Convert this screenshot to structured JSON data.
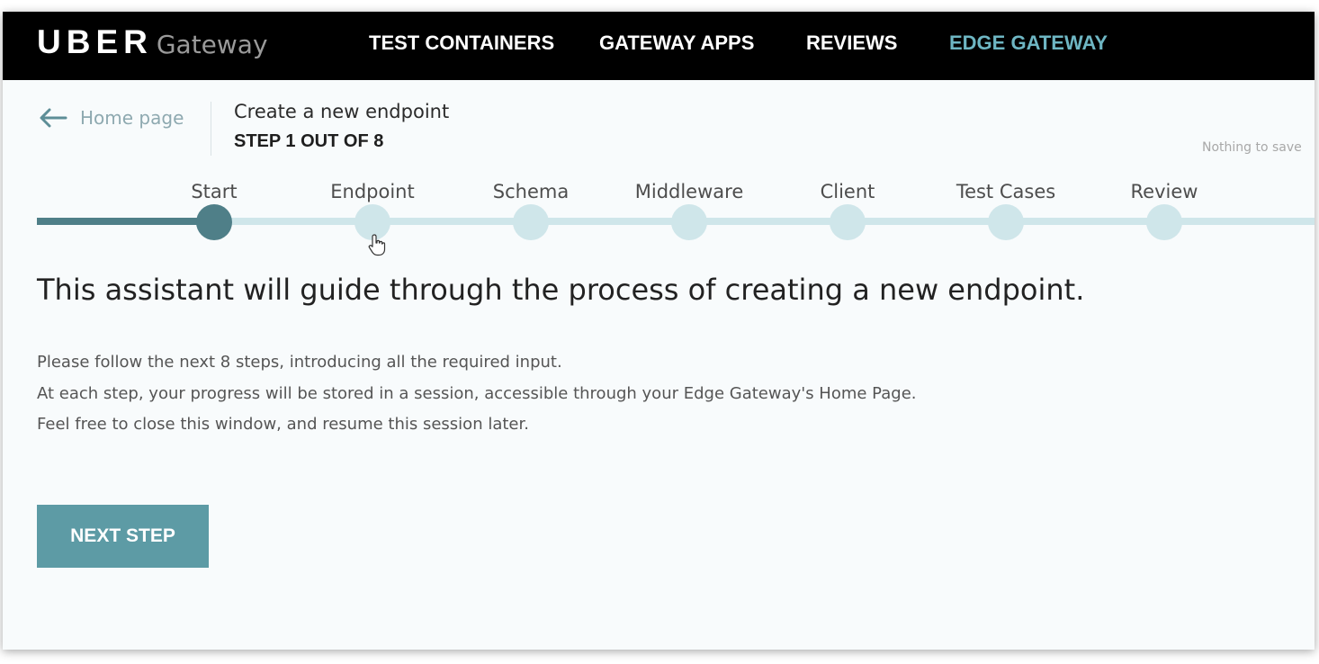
{
  "brand": {
    "name": "UBER",
    "product": "Gateway"
  },
  "nav": {
    "items": [
      {
        "label": "TEST CONTAINERS",
        "active": false
      },
      {
        "label": "GATEWAY APPS",
        "active": false
      },
      {
        "label": "REVIEWS",
        "active": false
      },
      {
        "label": "EDGE GATEWAY",
        "active": true
      }
    ]
  },
  "header": {
    "back_label": "Home page",
    "title": "Create a new endpoint",
    "step_indicator": "STEP 1 OUT OF 8",
    "save_status": "Nothing to save"
  },
  "stepper": {
    "current_step": 1,
    "steps": [
      {
        "label": "Start",
        "state": "done"
      },
      {
        "label": "Endpoint",
        "state": "pending"
      },
      {
        "label": "Schema",
        "state": "pending"
      },
      {
        "label": "Middleware",
        "state": "pending"
      },
      {
        "label": "Client",
        "state": "pending"
      },
      {
        "label": "Test Cases",
        "state": "pending"
      },
      {
        "label": "Review",
        "state": "pending"
      }
    ]
  },
  "main": {
    "headline": "This assistant will guide through the process of creating a new endpoint.",
    "paragraphs": [
      "Please follow the next 8 steps, introducing all the required input.",
      "At each step, your progress will be stored in a session, accessible through your Edge Gateway's Home Page.",
      "Feel free to close this window, and resume this session later."
    ],
    "next_button": "NEXT STEP"
  },
  "colors": {
    "accent": "#6eb6c3",
    "progress": "#4f7f88",
    "track": "#cfe6ea",
    "button": "#5d9ba5",
    "topbar": "#000000"
  }
}
